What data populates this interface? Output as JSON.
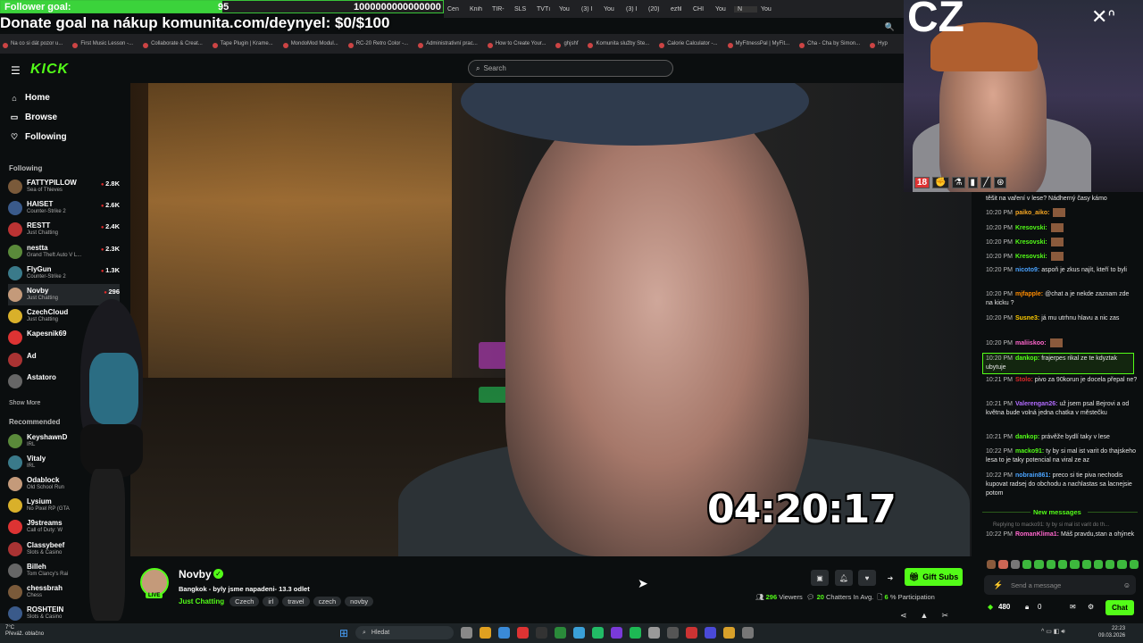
{
  "overlay": {
    "goal_label": "Follower goal:",
    "goal_current": "95",
    "goal_target": "1000000000000000",
    "goal_progress": 0.5,
    "donate_text": "Donate goal na nákup komunita.com/deynyel: $0/$100"
  },
  "browser": {
    "tabs": [
      "Cen",
      "Knih",
      "TIR-",
      "SLS",
      "TVTı",
      "You",
      "(3) I",
      "You",
      "(3) I",
      "(20)",
      "ezfil",
      "CHI",
      "You",
      "N",
      "You"
    ],
    "bookmarks": [
      "Na co si dát pozor u...",
      "First Music Lesson -...",
      "Collaborate & Creat...",
      "Tape Plugin | Krame...",
      "MondoMod Modul...",
      "RC-20 Retro Color -...",
      "Administrativní prac...",
      "How to Create Your...",
      "ghjshf",
      "Komunita služby Ste...",
      "Calorie Calculator -...",
      "MyFitnessPal | MyFit...",
      "Cha - Cha by Simon...",
      "Hyp"
    ]
  },
  "kick": {
    "logo": "KICK",
    "search_placeholder": "Search",
    "nav": [
      {
        "label": "Home",
        "icon": "home-icon"
      },
      {
        "label": "Browse",
        "icon": "browse-icon"
      },
      {
        "label": "Following",
        "icon": "heart-icon"
      }
    ],
    "following_title": "Following",
    "following": [
      {
        "name": "FATTYPILLOW",
        "game": "Sea of Thieves",
        "viewers": "2.8K"
      },
      {
        "name": "HAISET",
        "game": "Counter-Strike 2",
        "viewers": "2.6K"
      },
      {
        "name": "RESTT",
        "game": "Just Chatting",
        "viewers": "2.4K"
      },
      {
        "name": "nestta",
        "game": "Grand Theft Auto V L...",
        "viewers": "2.3K"
      },
      {
        "name": "FlyGun",
        "game": "Counter-Strike 2",
        "viewers": "1.3K"
      },
      {
        "name": "Novby",
        "game": "Just Chatting",
        "viewers": "296"
      },
      {
        "name": "CzechCloud",
        "game": "Just Chatting",
        "viewers": ""
      },
      {
        "name": "Kapesnik69",
        "game": "",
        "viewers": ""
      },
      {
        "name": "Ad",
        "game": "",
        "viewers": ""
      },
      {
        "name": "Astatoro",
        "game": "",
        "viewers": ""
      }
    ],
    "show_more": "Show More",
    "recommended_title": "Recommended",
    "recommended": [
      {
        "name": "KeyshawnD",
        "game": "IRL"
      },
      {
        "name": "Vitaly",
        "game": "IRL"
      },
      {
        "name": "Odablock",
        "game": "Old School Run"
      },
      {
        "name": "Lysium",
        "game": "No Pixel RP (GTA"
      },
      {
        "name": "J9streams",
        "game": "Call of Duty: W"
      },
      {
        "name": "Classybeef",
        "game": "Slots & Casino"
      },
      {
        "name": "Billeh",
        "game": "Tom Clancy's Rai"
      },
      {
        "name": "chessbrah",
        "game": "Chess"
      },
      {
        "name": "ROSHTEIN",
        "game": "Slots & Casino"
      }
    ]
  },
  "stream": {
    "timer": "04:20:17",
    "streamer": "Novby",
    "title": "Bangkok - byly jsme napadeni- 13.3 odlet",
    "category": "Just Chatting",
    "tags": [
      "Czech",
      "irl",
      "travel",
      "czech",
      "novby"
    ],
    "live_label": "LIVE",
    "gift_subs": "Gift Subs",
    "viewers": "296",
    "viewers_label": "Viewers",
    "chatters": "20",
    "chatters_label": "Chatters In Avg.",
    "participation": "6",
    "participation_label": "% Participation"
  },
  "webcam": {
    "text": "CZ",
    "badge": "18"
  },
  "chat": {
    "top_line_1": "těšit na vaření v lese? Nádherný časy kámo",
    "messages": [
      {
        "time": "10:20 PM",
        "user": "paiko_aiko:",
        "text": "",
        "color": "#f5a623",
        "emote": true
      },
      {
        "time": "10:20 PM",
        "user": "Kresovski:",
        "text": "",
        "color": "#53fc18",
        "emote": true
      },
      {
        "time": "10:20 PM",
        "user": "Kresovski:",
        "text": "",
        "color": "#53fc18",
        "emote": true
      },
      {
        "time": "10:20 PM",
        "user": "Kresovski:",
        "text": "",
        "color": "#53fc18",
        "emote": true
      },
      {
        "time": "10:20 PM",
        "user": "nicoto9:",
        "text": "aspoň je zkus najít, kteří to byli",
        "color": "#4aa3ff",
        "emote": false
      },
      {
        "time": "10:20 PM",
        "user": "mjfapple:",
        "text": "@chat a je nekde zaznam zde na kicku ?",
        "color": "#ff8c00",
        "emote": false
      },
      {
        "time": "10:20 PM",
        "user": "Susne3:",
        "text": "já mu utrhnu hlavu a nic zas",
        "color": "#ffcc00",
        "emote": false
      },
      {
        "time": "10:20 PM",
        "user": "maliiskoo:",
        "text": "",
        "color": "#ff66cc",
        "emote": true
      },
      {
        "time": "10:20 PM",
        "user": "dankop:",
        "text": "frajerpes rikal ze te kdyztak ubytuje",
        "color": "#53fc18",
        "emote": false,
        "highlight": true
      },
      {
        "time": "10:21 PM",
        "user": "Stolo:",
        "text": "pivo za 90korun je docela přepal ne?",
        "color": "#e02b2b",
        "emote": false
      },
      {
        "time": "10:21 PM",
        "user": "Valerengan26:",
        "text": "už jsem psal Bejrovi a od května bude volná jedna chatka v městečku",
        "color": "#b26bff",
        "emote": false
      },
      {
        "time": "10:21 PM",
        "user": "dankop:",
        "text": "právěže bydlí taky v lese",
        "color": "#53fc18",
        "emote": false
      },
      {
        "time": "10:22 PM",
        "user": "macko91:",
        "text": "ty by si mal ist varit do thajskeho lesa to je taky potencial na viral ze az",
        "color": "#53fc18",
        "emote": false
      },
      {
        "time": "10:22 PM",
        "user": "nobrain861:",
        "text": "preco si tie piva nechodis kupovat radsej do obchodu a nachlastas sa lacnejsie potom",
        "color": "#4aa3ff",
        "emote": false
      }
    ],
    "new_messages": "New messages",
    "reply_preview": "Replying to macko91: ty by si mal ist varit do th...",
    "last_msg": {
      "time": "10:22 PM",
      "user": "RomanKlima1:",
      "text": "Máš pravdu,stan a ohýnek",
      "color": "#ff66cc"
    },
    "input_placeholder": "Send a message",
    "points": "480",
    "zero": "0",
    "send_label": "Chat"
  },
  "taskbar": {
    "weather_temp": "7°C",
    "weather_desc": "Převáž. oblačno",
    "search_label": "Hledat",
    "time": "22:23",
    "date": "09.03.2026"
  }
}
